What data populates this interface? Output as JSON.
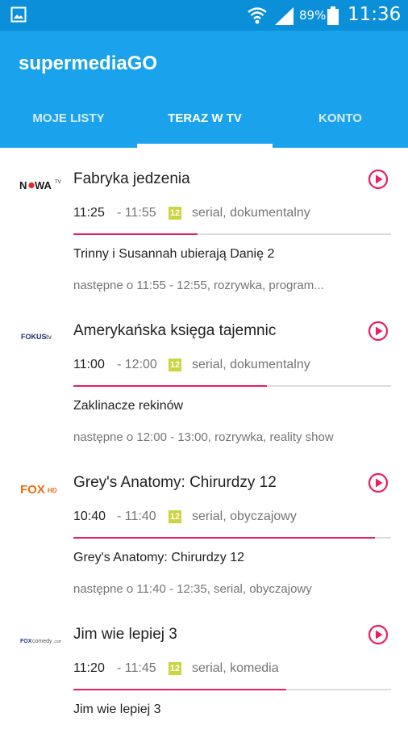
{
  "status_bar": {
    "battery_percent": "89%",
    "time": "11:36",
    "icons": [
      "gallery-icon",
      "wifi-icon",
      "signal-icon",
      "battery-icon"
    ]
  },
  "app": {
    "title": "supermediaGO"
  },
  "tabs": [
    {
      "label": "MOJE LISTY",
      "active": false
    },
    {
      "label": "TERAZ W TV",
      "active": true
    },
    {
      "label": "KONTO",
      "active": false
    }
  ],
  "colors": {
    "app_bar": "#1aa3ec",
    "status_bar": "#0b8fd9",
    "accent": "#e91e63",
    "age_badge": "#c9d43e"
  },
  "programs": [
    {
      "channel": "Nowa TV",
      "logo_icon": "nowa-tv-logo",
      "title": "Fabryka jedzenia",
      "start": "11:25",
      "end": "- 11:55",
      "age_rating": "12",
      "genre": "serial, dokumentalny",
      "progress": 0.39,
      "next_title": "Trinny i Susannah ubierają Danię 2",
      "next_info": "następne o 11:55 - 12:55, rozrywka, program..."
    },
    {
      "channel": "Fokus TV",
      "logo_icon": "fokus-tv-logo",
      "title": "Amerykańska księga tajemnic",
      "start": "11:00",
      "end": "- 12:00",
      "age_rating": "12",
      "genre": "serial, dokumentalny",
      "progress": 0.61,
      "next_title": "Zaklinacze rekinów",
      "next_info": "następne o 12:00 - 13:00, rozrywka, reality show"
    },
    {
      "channel": "Fox HD",
      "logo_icon": "fox-hd-logo",
      "title": "Grey's Anatomy: Chirurdzy 12",
      "start": "10:40",
      "end": "- 11:40",
      "age_rating": "12",
      "genre": "serial, obyczajowy",
      "progress": 0.95,
      "next_title": "Grey's Anatomy: Chirurdzy 12",
      "next_info": "następne o 11:40 - 12:35, serial, obyczajowy"
    },
    {
      "channel": "Fox Comedy",
      "logo_icon": "fox-comedy-logo",
      "title": "Jim wie lepiej 3",
      "start": "11:20",
      "end": "- 11:45",
      "age_rating": "12",
      "genre": "serial, komedia",
      "progress": 0.67,
      "next_title": "Jim wie lepiej 3",
      "next_info": ""
    }
  ]
}
